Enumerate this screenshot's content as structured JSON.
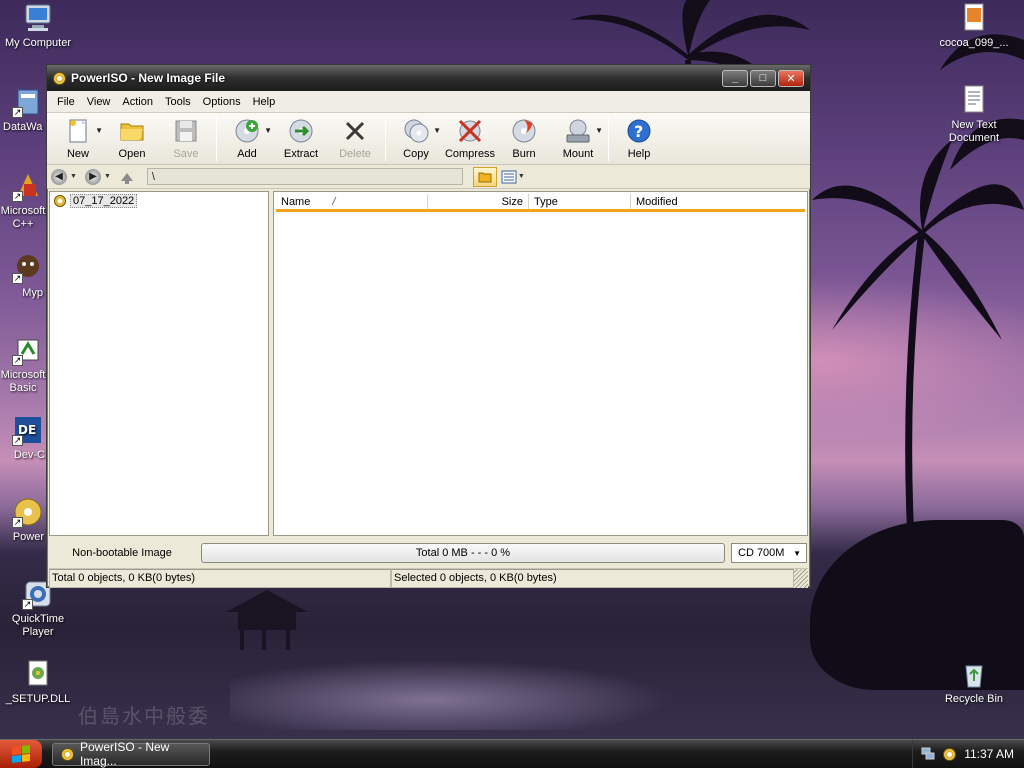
{
  "desktop": {
    "icons": [
      {
        "label": "My Computer"
      },
      {
        "label": "DataWa"
      },
      {
        "label": "Microsoft C++"
      },
      {
        "label": "Myp"
      },
      {
        "label": "Microsoft Basic"
      },
      {
        "label": "Dev-C"
      },
      {
        "label": "Power"
      },
      {
        "label": "QuickTime Player"
      },
      {
        "label": "_SETUP.DLL"
      },
      {
        "label": "cocoa_099_..."
      },
      {
        "label": "New Text Document"
      },
      {
        "label": "Recycle Bin"
      }
    ],
    "watermark": "伯島水中般委"
  },
  "window": {
    "title": "PowerISO - New Image File",
    "controls": {
      "minimize": "_",
      "maximize": "□",
      "close": "✕"
    }
  },
  "menu": [
    "File",
    "View",
    "Action",
    "Tools",
    "Options",
    "Help"
  ],
  "toolbar": {
    "new": "New",
    "open": "Open",
    "save": "Save",
    "add": "Add",
    "extract": "Extract",
    "delete": "Delete",
    "copy": "Copy",
    "compress": "Compress",
    "burn": "Burn",
    "mount": "Mount",
    "help": "Help"
  },
  "address": {
    "path": "\\"
  },
  "tree": {
    "root": "07_17_2022"
  },
  "list": {
    "columns": [
      "Name",
      "/",
      "Size",
      "Type",
      "Modified"
    ]
  },
  "status": {
    "bootable": "Non-bootable Image",
    "total": "Total  0 MB   - - -  0 %",
    "media": "CD 700M",
    "total_objects": "Total 0 objects, 0 KB(0 bytes)",
    "selected_objects": "Selected 0 objects, 0 KB(0 bytes)"
  },
  "taskbar": {
    "task_label": "PowerISO - New Imag...",
    "clock": "11:37 AM"
  }
}
